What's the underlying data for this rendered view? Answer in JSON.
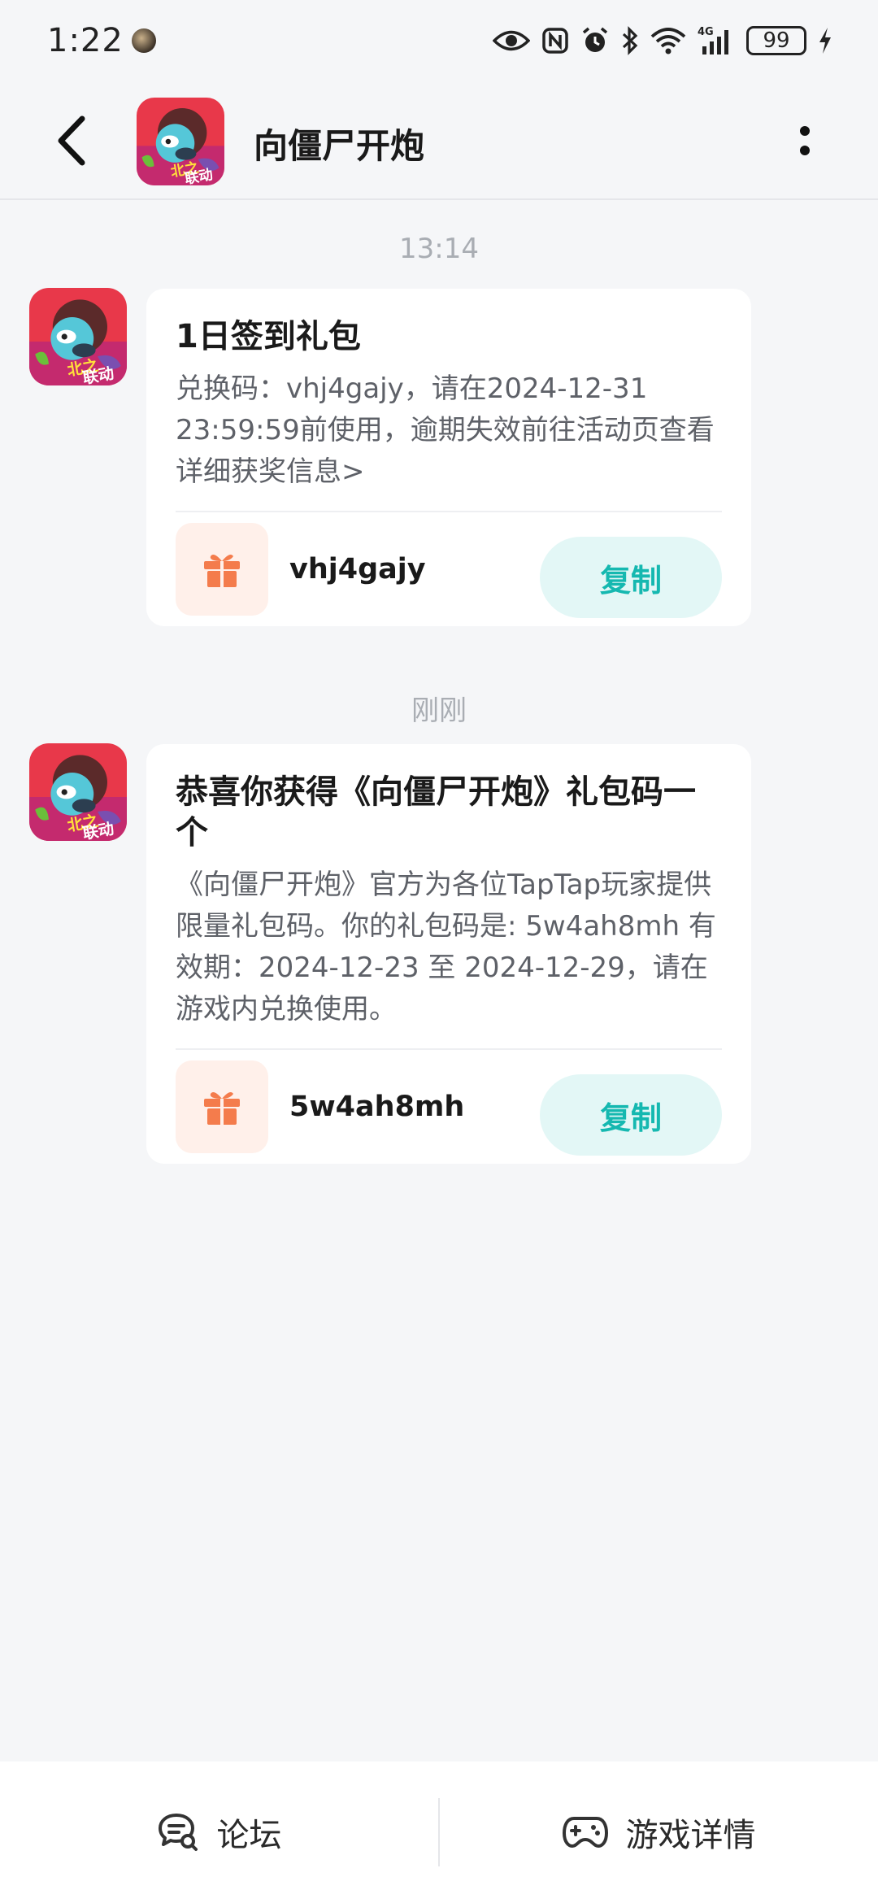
{
  "status_bar": {
    "time": "1:22",
    "battery": "99"
  },
  "header": {
    "title": "向僵尸开炮"
  },
  "messages": [
    {
      "time_label": "13:14",
      "title": "1日签到礼包",
      "body": "兑换码：vhj4gajy，请在2024-12-31 23:59:59前使用，逾期失效前往活动页查看详细获奖信息>",
      "code": "vhj4gajy",
      "copy_label": "复制"
    },
    {
      "time_label": "刚刚",
      "title": "恭喜你获得《向僵尸开炮》礼包码一个",
      "body": "《向僵尸开炮》官方为各位TapTap玩家提供限量礼包码。你的礼包码是: 5w4ah8mh 有效期：2024-12-23 至 2024-12-29，请在游戏内兑换使用。",
      "code": "5w4ah8mh",
      "copy_label": "复制"
    }
  ],
  "bottom_bar": {
    "forum_label": "论坛",
    "game_details_label": "游戏详情"
  },
  "colors": {
    "accent": "#15B8B0",
    "copy_bg": "#E3F7F6",
    "gift": "#F47C4C",
    "gift_bg": "#FFF0EA",
    "page_bg": "#F5F6F8"
  }
}
